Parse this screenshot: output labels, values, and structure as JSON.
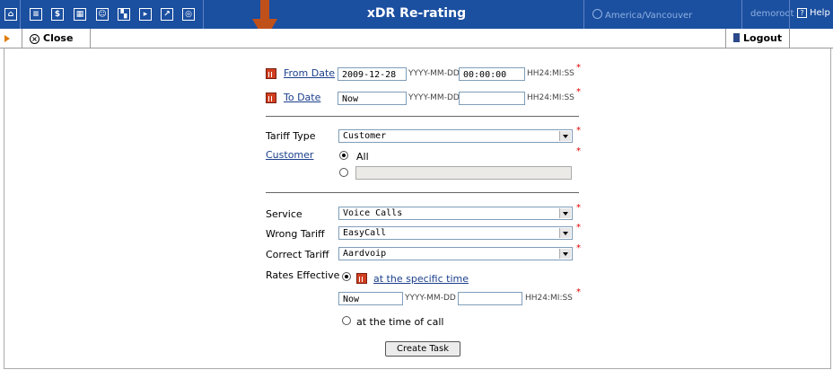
{
  "header": {
    "title": "xDR Re-rating",
    "timezone": "America/Vancouver",
    "user": "demoroot",
    "help": "Help",
    "icons": [
      "home-icon",
      "list-icon",
      "dollar-icon",
      "grid-icon",
      "person-icon",
      "hierarchy-icon",
      "export-icon",
      "chart-icon",
      "search-icon"
    ]
  },
  "toolbar": {
    "close_label": "Close",
    "logout_label": "Logout"
  },
  "form": {
    "from_date": {
      "label": "From Date",
      "date": "2009-12-28",
      "date_hint": "YYYY-MM-DD",
      "time": "00:00:00",
      "time_hint": "HH24:MI:SS"
    },
    "to_date": {
      "label": "To Date",
      "date": "Now",
      "date_hint": "YYYY-MM-DD",
      "time": "",
      "time_hint": "HH24:MI:SS"
    },
    "tariff_type": {
      "label": "Tariff Type",
      "value": "Customer"
    },
    "customer": {
      "label": "Customer",
      "all_label": "All",
      "specific_value": ""
    },
    "service": {
      "label": "Service",
      "value": "Voice Calls"
    },
    "wrong_tariff": {
      "label": "Wrong Tariff",
      "value": "EasyCall"
    },
    "correct_tariff": {
      "label": "Correct Tariff",
      "value": "Aardvoip"
    },
    "rates_effective": {
      "label": "Rates Effective",
      "specific_label": "at the specific time",
      "date": "Now",
      "date_hint": "YYYY-MM-DD",
      "time": "",
      "time_hint": "HH24:MI:SS",
      "call_label": "at the time of call"
    },
    "required_mark": "*",
    "create_button": "Create Task"
  },
  "colors": {
    "header_bg": "#1b4fa0",
    "arrow": "#c0501a",
    "required": "#dd0000",
    "link": "#1b3f8b"
  }
}
